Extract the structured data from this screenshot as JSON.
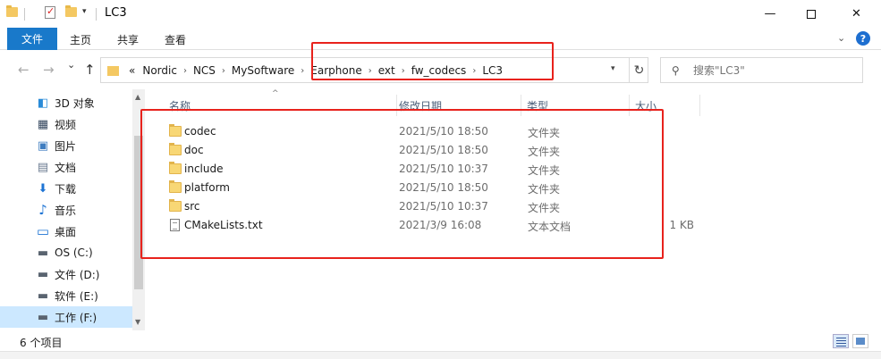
{
  "window": {
    "title": "LC3",
    "minimize_glyph": "—",
    "close_glyph": "✕"
  },
  "ribbon": {
    "tabs": [
      "文件",
      "主页",
      "共享",
      "查看"
    ],
    "expand_glyph": "⌄",
    "help_glyph": "?"
  },
  "nav": {
    "back_glyph": "←",
    "forward_glyph": "→",
    "recent_glyph": "⌄",
    "up_glyph": "↑",
    "overflow": "«",
    "breadcrumbs": [
      "Nordic",
      "NCS",
      "MySoftware",
      "Earphone",
      "ext",
      "fw_codecs",
      "LC3"
    ],
    "separator": "›",
    "refresh_glyph": "↻"
  },
  "search": {
    "placeholder": "搜索\"LC3\"",
    "icon_glyph": "⚲"
  },
  "sidebar": {
    "items": [
      {
        "label": "3D 对象",
        "icon": "cube-icon",
        "glyph": "◧"
      },
      {
        "label": "视频",
        "icon": "video-icon",
        "glyph": "▦"
      },
      {
        "label": "图片",
        "icon": "picture-icon",
        "glyph": "▣"
      },
      {
        "label": "文档",
        "icon": "document-icon",
        "glyph": "▤"
      },
      {
        "label": "下载",
        "icon": "download-icon",
        "glyph": "⬇"
      },
      {
        "label": "音乐",
        "icon": "music-icon",
        "glyph": "♪"
      },
      {
        "label": "桌面",
        "icon": "desktop-icon",
        "glyph": "▭"
      },
      {
        "label": "OS (C:)",
        "icon": "drive-c-icon",
        "glyph": "▬"
      },
      {
        "label": "文件 (D:)",
        "icon": "drive-d-icon",
        "glyph": "▬"
      },
      {
        "label": "软件 (E:)",
        "icon": "drive-e-icon",
        "glyph": "▬"
      },
      {
        "label": "工作 (F:)",
        "icon": "drive-f-icon",
        "glyph": "▬",
        "selected": true
      }
    ]
  },
  "columns": {
    "name": "名称",
    "modified": "修改日期",
    "type": "类型",
    "size": "大小",
    "sort_glyph": "^"
  },
  "files": [
    {
      "name": "codec",
      "modified": "2021/5/10 18:50",
      "type": "文件夹",
      "size": "",
      "kind": "folder"
    },
    {
      "name": "doc",
      "modified": "2021/5/10 18:50",
      "type": "文件夹",
      "size": "",
      "kind": "folder"
    },
    {
      "name": "include",
      "modified": "2021/5/10 10:37",
      "type": "文件夹",
      "size": "",
      "kind": "folder"
    },
    {
      "name": "platform",
      "modified": "2021/5/10 18:50",
      "type": "文件夹",
      "size": "",
      "kind": "folder"
    },
    {
      "name": "src",
      "modified": "2021/5/10 10:37",
      "type": "文件夹",
      "size": "",
      "kind": "folder"
    },
    {
      "name": "CMakeLists.txt",
      "modified": "2021/3/9 16:08",
      "type": "文本文档",
      "size": "1 KB",
      "kind": "text"
    }
  ],
  "status": {
    "item_count": "6 个项目"
  },
  "colors": {
    "accent": "#1979ca",
    "highlight_box": "#e8221c",
    "selected_bg": "#cce8ff"
  }
}
